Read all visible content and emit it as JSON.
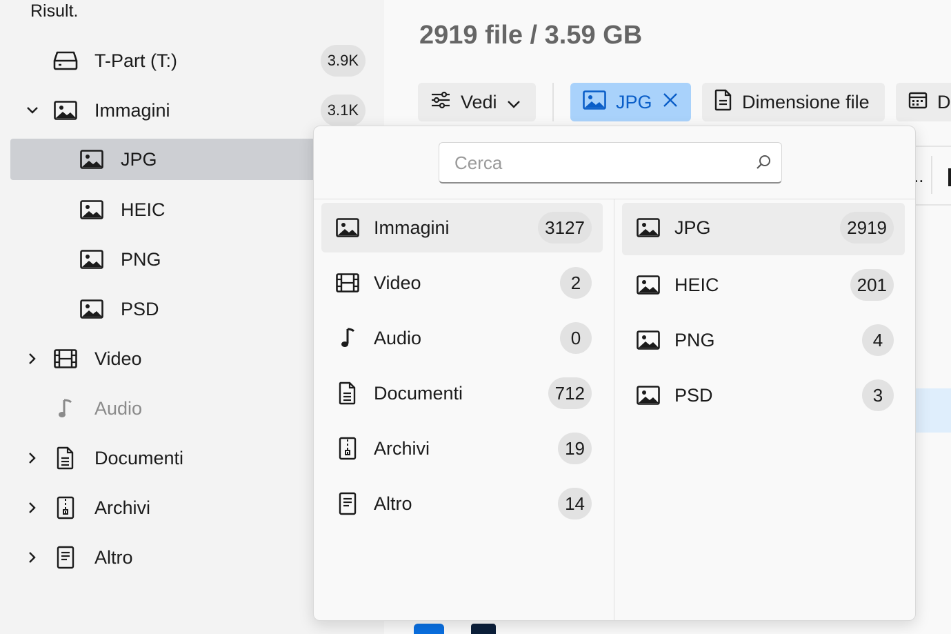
{
  "sidebar": {
    "title": "Risult.",
    "items": [
      {
        "label": "T-Part (T:)",
        "badge": "3.9K",
        "icon": "drive-icon"
      },
      {
        "label": "Immagini",
        "badge": "3.1K",
        "icon": "image-icon",
        "expanded": true
      },
      {
        "label": "JPG",
        "icon": "image-icon",
        "selected": true
      },
      {
        "label": "HEIC",
        "icon": "image-icon"
      },
      {
        "label": "PNG",
        "icon": "image-icon"
      },
      {
        "label": "PSD",
        "icon": "image-icon"
      },
      {
        "label": "Video",
        "icon": "film-icon"
      },
      {
        "label": "Audio",
        "icon": "music-note-icon",
        "disabled": true
      },
      {
        "label": "Documenti",
        "icon": "document-icon"
      },
      {
        "label": "Archivi",
        "icon": "archive-icon"
      },
      {
        "label": "Altro",
        "icon": "other-file-icon"
      }
    ]
  },
  "main": {
    "title": "2919 file / 3.59 GB",
    "toolbar": {
      "view_label": "Vedi",
      "filter_chip_label": "JPG",
      "size_label": "Dimensione file",
      "date_label_partial": "D"
    },
    "cutoff_text": ".."
  },
  "popup": {
    "search_placeholder": "Cerca",
    "categories": [
      {
        "label": "Immagini",
        "count": "3127",
        "icon": "image-icon",
        "selected": true
      },
      {
        "label": "Video",
        "count": "2",
        "icon": "film-icon"
      },
      {
        "label": "Audio",
        "count": "0",
        "icon": "music-note-icon"
      },
      {
        "label": "Documenti",
        "count": "712",
        "icon": "document-icon"
      },
      {
        "label": "Archivi",
        "count": "19",
        "icon": "archive-icon"
      },
      {
        "label": "Altro",
        "count": "14",
        "icon": "other-file-icon"
      }
    ],
    "subtypes": [
      {
        "label": "JPG",
        "count": "2919",
        "icon": "image-icon",
        "selected": true
      },
      {
        "label": "HEIC",
        "count": "201",
        "icon": "image-icon"
      },
      {
        "label": "PNG",
        "count": "4",
        "icon": "image-icon"
      },
      {
        "label": "PSD",
        "count": "3",
        "icon": "image-icon"
      }
    ]
  },
  "colors": {
    "accent": "#0a5ec8",
    "chip_active_bg": "#a9d2fb",
    "sidebar_bg": "#f3f3f3",
    "selected_row_bg": "#cdcfd3"
  }
}
